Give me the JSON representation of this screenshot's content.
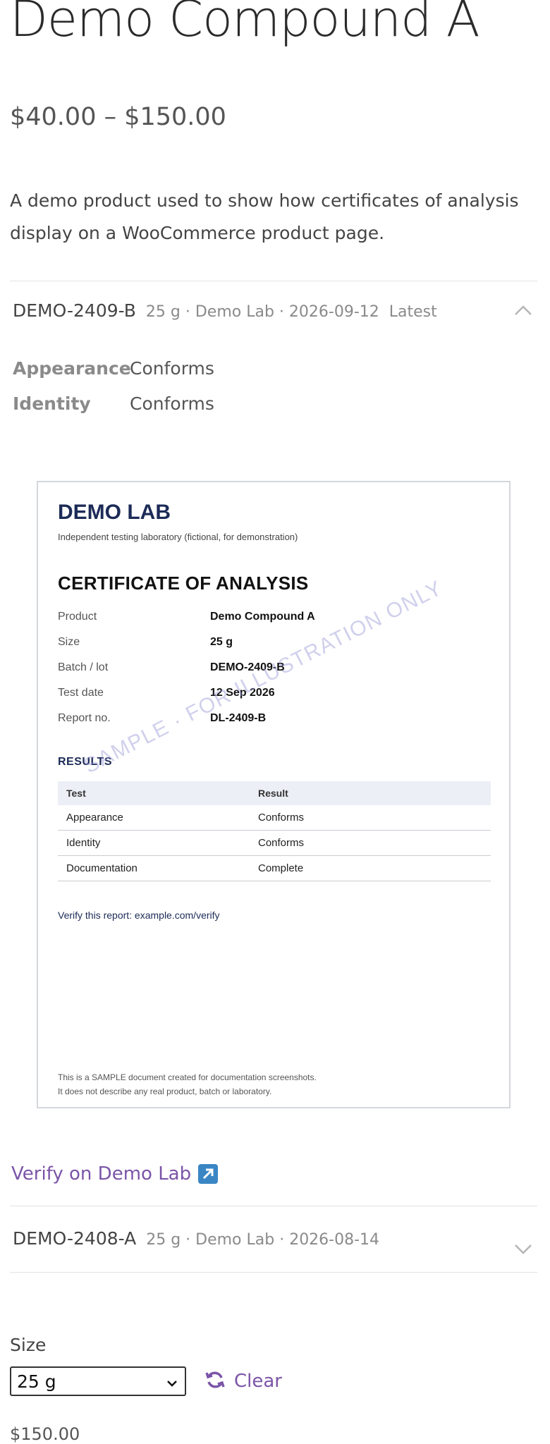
{
  "product": {
    "title": "Demo Compound A",
    "price_range": "$40.00 – $150.00",
    "description": "A demo product used to show how certificates of analysis display on a WooCommerce product page."
  },
  "batches": [
    {
      "id": "DEMO-2409-B",
      "meta": "25 g · Demo Lab · 2026-09-12",
      "badge": "Latest",
      "expanded": true,
      "results": [
        {
          "label": "Appearance",
          "value": "Conforms"
        },
        {
          "label": "Identity",
          "value": "Conforms"
        }
      ],
      "verify_link": "Verify on Demo Lab"
    },
    {
      "id": "DEMO-2408-A",
      "meta": "25 g · Demo Lab · 2026-08-14",
      "expanded": false
    }
  ],
  "certificate": {
    "lab_name": "DEMO LAB",
    "lab_subtitle": "Independent testing laboratory (fictional, for demonstration)",
    "title": "CERTIFICATE OF ANALYSIS",
    "fields": [
      {
        "label": "Product",
        "value": "Demo Compound A"
      },
      {
        "label": "Size",
        "value": "25 g"
      },
      {
        "label": "Batch / lot",
        "value": "DEMO-2409-B"
      },
      {
        "label": "Test date",
        "value": "12 Sep 2026"
      },
      {
        "label": "Report no.",
        "value": "DL-2409-B"
      }
    ],
    "results_heading": "RESULTS",
    "table_headers": [
      "Test",
      "Result"
    ],
    "table_rows": [
      [
        "Appearance",
        "Conforms"
      ],
      [
        "Identity",
        "Conforms"
      ],
      [
        "Documentation",
        "Complete"
      ]
    ],
    "verify_text": "Verify this report: example.com/verify",
    "watermark": "SAMPLE · FOR ILLUSTRATION ONLY",
    "footer_lines": [
      "This is a SAMPLE document created for documentation screenshots.",
      "It does not describe any real product, batch or laboratory."
    ]
  },
  "variations": {
    "size_label": "Size",
    "selected_size": "25 g",
    "clear_label": "Clear",
    "variation_price": "$150.00"
  },
  "colors": {
    "link": "#7b55a8",
    "cert_heading": "#1c2b57",
    "external_icon": "#3a86c4"
  },
  "icons": {
    "chevron_up": "chevron-up-icon",
    "chevron_down": "chevron-down-icon",
    "external_link": "external-link-icon",
    "refresh": "refresh-icon",
    "select_caret": "chevron-down-icon"
  }
}
